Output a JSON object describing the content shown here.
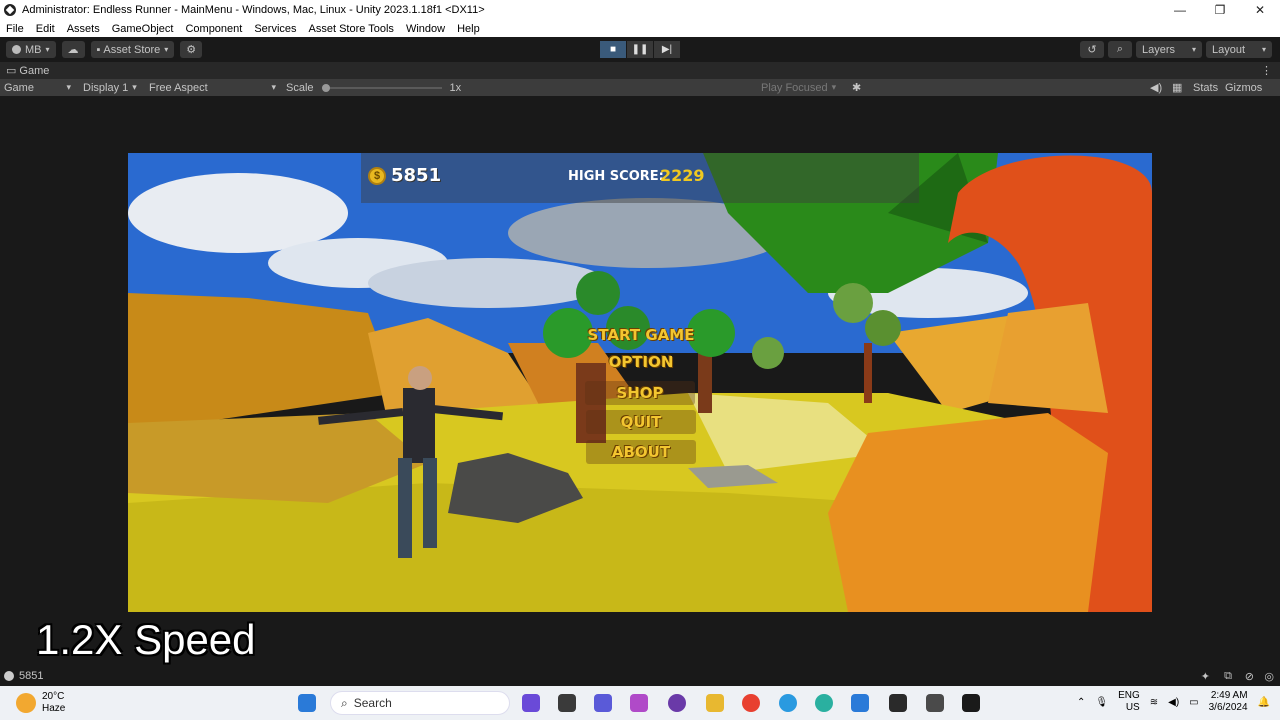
{
  "window": {
    "title": "Administrator: Endless Runner - MainMenu - Windows, Mac, Linux - Unity 2023.1.18f1 <DX11>",
    "controls": [
      "—",
      "❐",
      "✕"
    ]
  },
  "menubar": [
    "File",
    "Edit",
    "Assets",
    "GameObject",
    "Component",
    "Services",
    "Asset Store Tools",
    "Window",
    "Help"
  ],
  "toolbar": {
    "account": "MB",
    "asset_store": "Asset Store",
    "layers": "Layers",
    "layout": "Layout"
  },
  "game_tab": {
    "label": "Game"
  },
  "game_toolbar": {
    "mode": "Game",
    "display": "Display 1",
    "aspect": "Free Aspect",
    "scale_label": "Scale",
    "scale_value": "1x",
    "play_focused": "Play Focused",
    "stats": "Stats",
    "gizmos": "Gizmos"
  },
  "game": {
    "coins": "5851",
    "high_score_label": "HIGH SCORE:",
    "high_score_value": "2229",
    "menu": [
      "START GAME",
      "OPTION",
      "SHOP",
      "QUIT",
      "ABOUT"
    ]
  },
  "overlay": {
    "speed": "1.2X Speed"
  },
  "statusbar": {
    "message": "5851"
  },
  "taskbar": {
    "temperature": "20°C",
    "condition": "Haze",
    "search_placeholder": "Search",
    "lang": "ENG",
    "region": "US",
    "time": "2:49 AM",
    "date": "3/6/2024"
  }
}
